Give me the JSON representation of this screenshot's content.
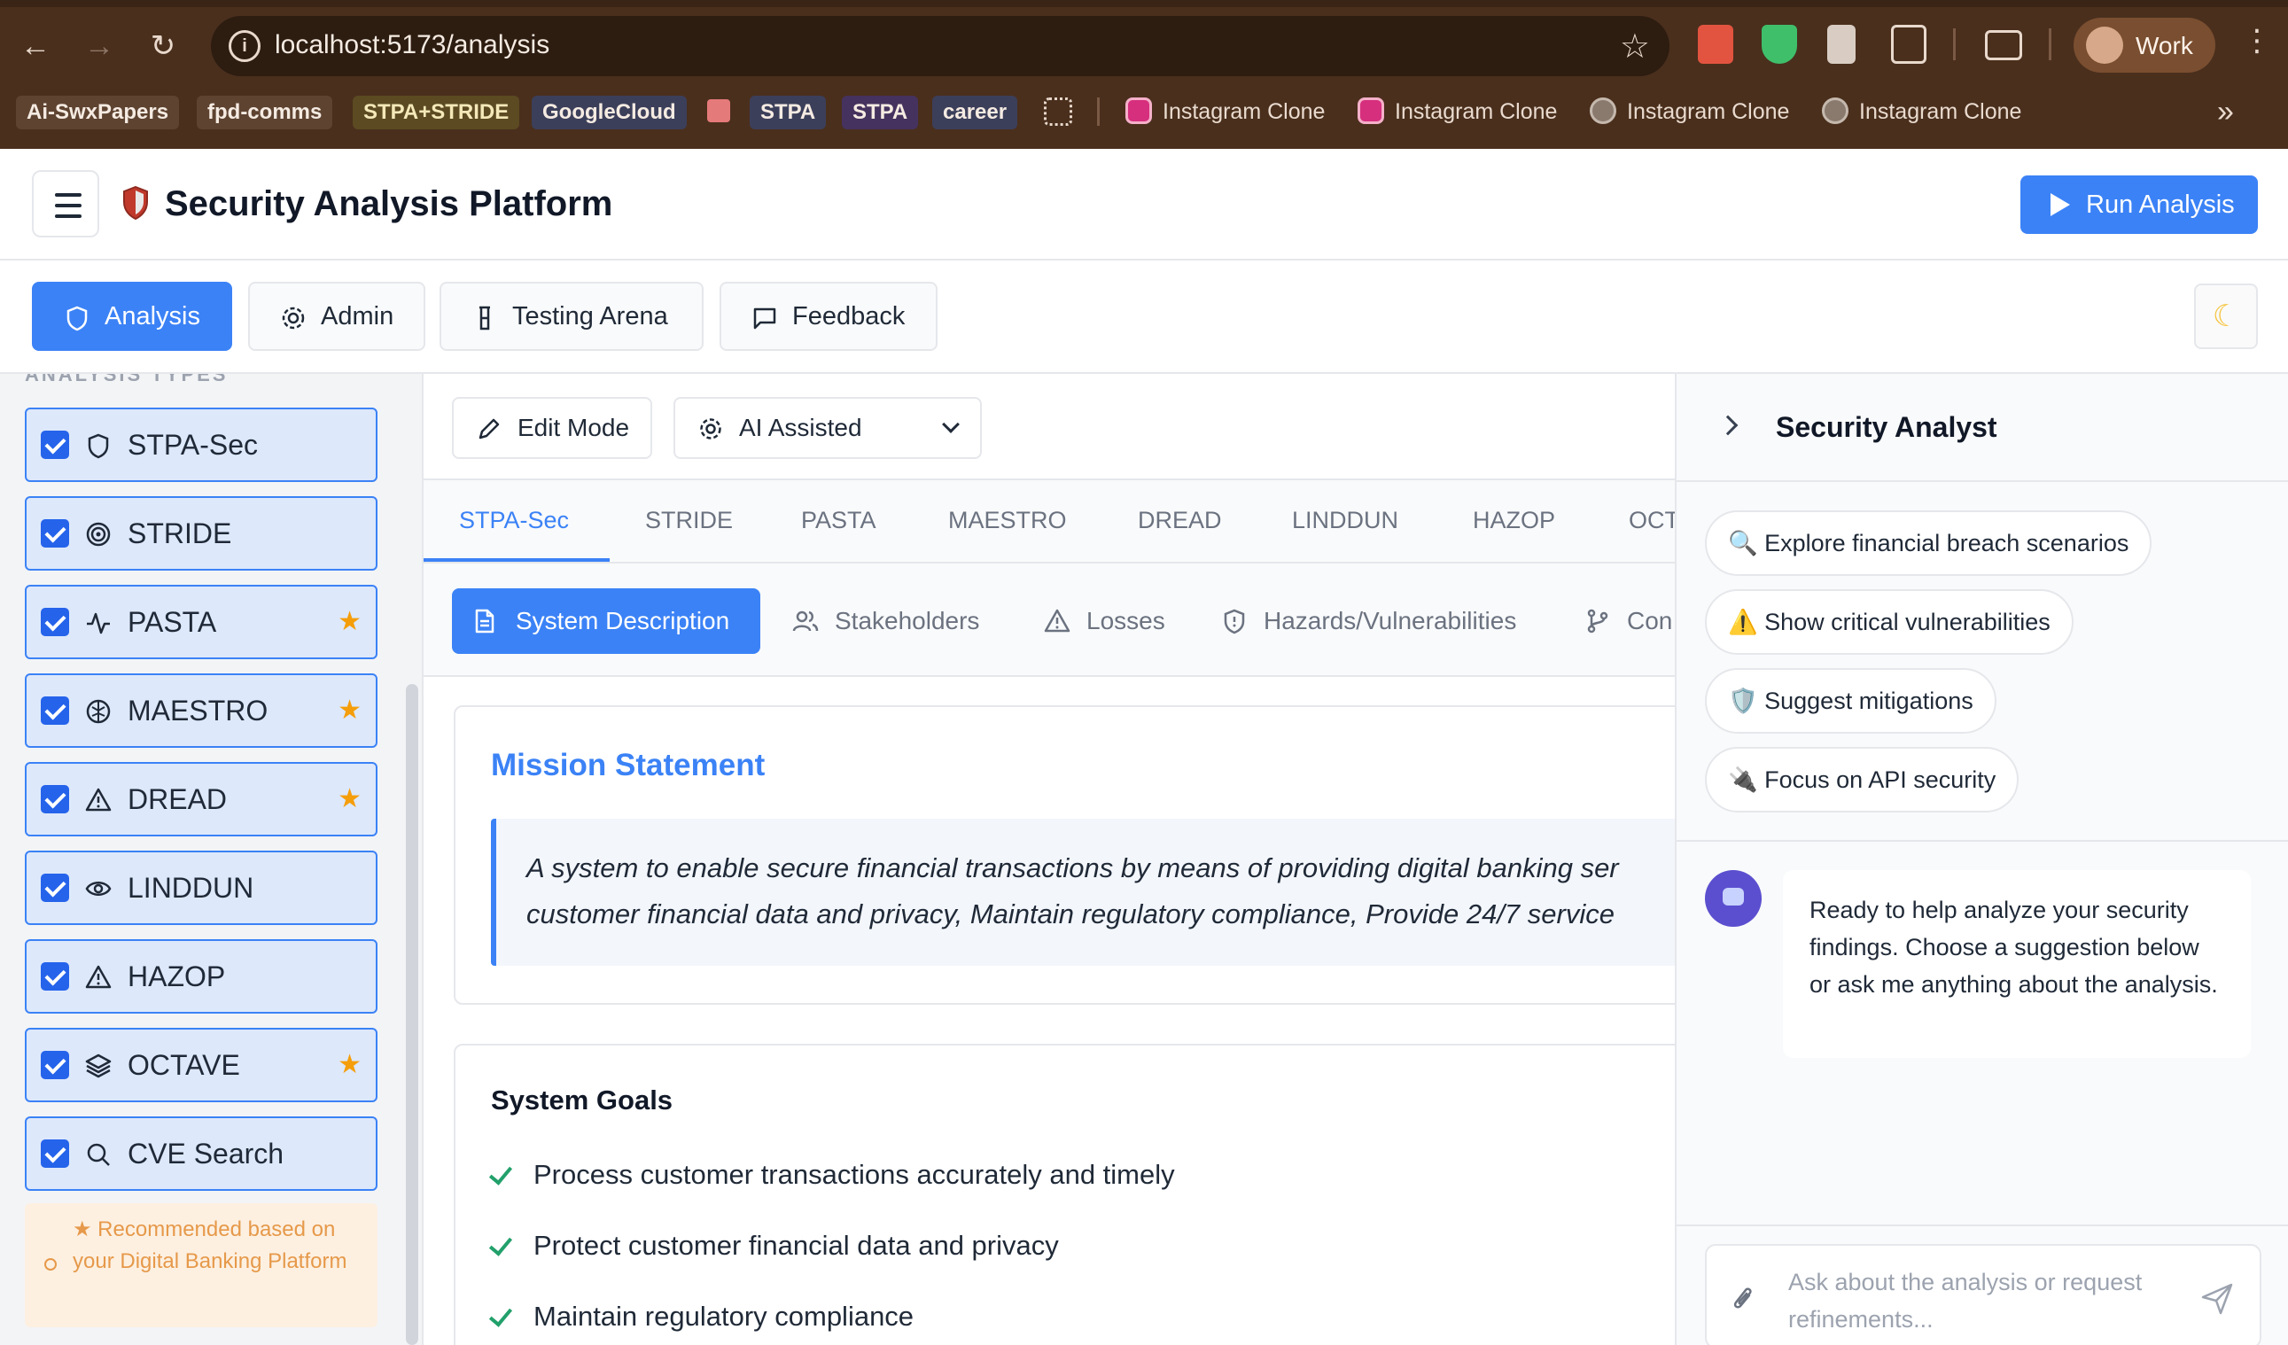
{
  "browser": {
    "url": "localhost:5173/analysis",
    "profile_name": "Work",
    "bookmarks": [
      "Ai-SwxPapers",
      "fpd-comms",
      "STPA+STRIDE",
      "GoogleCloud",
      "STPA",
      "STPA",
      "career"
    ],
    "bookmark_links": [
      "Instagram Clone",
      "Instagram Clone",
      "Instagram Clone",
      "Instagram Clone"
    ],
    "overflow": "»"
  },
  "header": {
    "title": "Security Analysis Platform",
    "run_label": "Run Analysis"
  },
  "tabs": {
    "analysis": "Analysis",
    "admin": "Admin",
    "testing": "Testing Arena",
    "feedback": "Feedback"
  },
  "sidebar": {
    "heading": "ANALYSIS TYPES",
    "items": [
      {
        "label": "STPA-Sec",
        "icon": "shield-icon",
        "recommended": false
      },
      {
        "label": "STRIDE",
        "icon": "target-icon",
        "recommended": false
      },
      {
        "label": "PASTA",
        "icon": "activity-icon",
        "recommended": true
      },
      {
        "label": "MAESTRO",
        "icon": "brain-icon",
        "recommended": true
      },
      {
        "label": "DREAD",
        "icon": "warning-icon",
        "recommended": true
      },
      {
        "label": "LINDDUN",
        "icon": "eye-icon",
        "recommended": false
      },
      {
        "label": "HAZOP",
        "icon": "warning-icon",
        "recommended": false
      },
      {
        "label": "OCTAVE",
        "icon": "layers-icon",
        "recommended": true
      },
      {
        "label": "CVE Search",
        "icon": "search-icon",
        "recommended": false
      }
    ],
    "star": "★",
    "recommendation": "★ Recommended based on your Digital Banking Platform"
  },
  "main": {
    "edit_mode": "Edit Mode",
    "ai_mode": "AI Assisted",
    "framework_tabs": [
      "STPA-Sec",
      "STRIDE",
      "PASTA",
      "MAESTRO",
      "DREAD",
      "LINDDUN",
      "HAZOP",
      "OCT"
    ],
    "section_tabs": [
      "System Description",
      "Stakeholders",
      "Losses",
      "Hazards/Vulnerabilities",
      "Con"
    ],
    "mission_title": "Mission Statement",
    "mission_line1": "A system to enable secure financial transactions by means of providing digital banking ser",
    "mission_line2": "customer financial data and privacy, Maintain regulatory compliance, Provide 24/7 service",
    "goals_title": "System Goals",
    "goals": [
      "Process customer transactions accurately and timely",
      "Protect customer financial data and privacy",
      "Maintain regulatory compliance"
    ]
  },
  "assistant": {
    "title": "Security Analyst",
    "suggestions": [
      "🔍 Explore financial breach scenarios",
      "⚠️ Show critical vulnerabilities",
      "🛡️ Suggest mitigations",
      "🔌 Focus on API security"
    ],
    "message": "Ready to help analyze your security findings. Choose a suggestion below or ask me anything about the analysis.",
    "input_placeholder": "Ask about the analysis or request refinements..."
  },
  "colors": {
    "accent": "#3b82f6",
    "star": "#f59e0b",
    "check": "#22a06b"
  }
}
